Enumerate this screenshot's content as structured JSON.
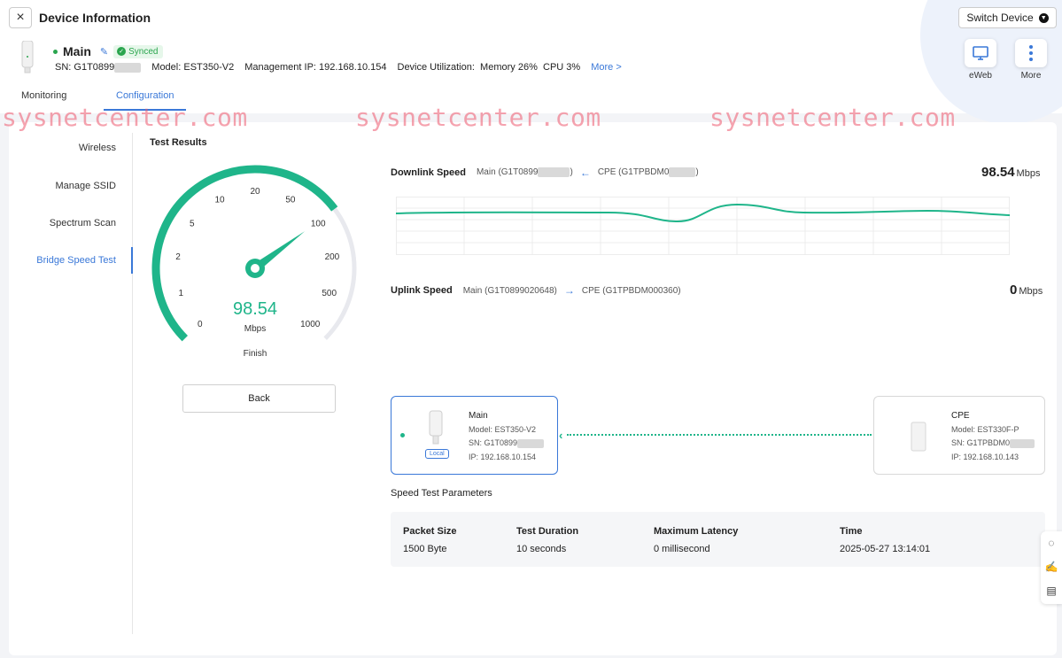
{
  "header": {
    "close_icon": "×",
    "title": "Device Information",
    "switch_device_label": "Switch Device",
    "switch_device_icon": "chevron-down-icon"
  },
  "device": {
    "name": "Main",
    "synced_label": "Synced",
    "sn_label": "SN:",
    "sn_value": "G1T0899",
    "model_label": "Model:",
    "model_value": "EST350-V2",
    "mgmt_ip_label": "Management IP:",
    "mgmt_ip_value": "192.168.10.154",
    "utilization_label": "Device Utilization:",
    "memory_label": "Memory",
    "memory_value": "26%",
    "cpu_label": "CPU",
    "cpu_value": "3%",
    "more_label": "More >"
  },
  "actions": {
    "eweb_label": "eWeb",
    "more_label": "More"
  },
  "tabs": [
    {
      "label": "Monitoring",
      "active": false
    },
    {
      "label": "Configuration",
      "active": true
    }
  ],
  "watermark": "sysnetcenter.com",
  "sidenav": [
    {
      "label": "Wireless",
      "active": false
    },
    {
      "label": "Manage SSID",
      "active": false
    },
    {
      "label": "Spectrum Scan",
      "active": false
    },
    {
      "label": "Bridge Speed Test",
      "active": true
    }
  ],
  "gauge": {
    "section_title": "Test Results",
    "value": "98.54",
    "value_number": 98.54,
    "unit": "Mbps",
    "status": "Finish",
    "ticks": [
      "0",
      "1",
      "2",
      "5",
      "10",
      "20",
      "50",
      "100",
      "200",
      "500",
      "1000"
    ],
    "colors": {
      "fill": "#1fb58a",
      "track": "#e8e9ee"
    }
  },
  "back_label": "Back",
  "downlink": {
    "label": "Downlink Speed",
    "from": "Main",
    "from_sn": "(G1T0899",
    "to": "CPE",
    "to_sn": "(G1TPBDM0",
    "close_paren": ")",
    "value": "98.54",
    "unit": "Mbps"
  },
  "uplink": {
    "label": "Uplink Speed",
    "from": "Main",
    "from_sn": "(G1T0899020648)",
    "to": "CPE",
    "to_sn": "(G1TPBDM000360)",
    "value": "0",
    "unit": "Mbps"
  },
  "main_card": {
    "name": "Main",
    "model": "Model:  EST350-V2",
    "sn": "SN:  G1T0899",
    "ip": "IP:  192.168.10.154",
    "badge": "Local"
  },
  "cpe_card": {
    "name": "CPE",
    "model": "Model:  EST330F-P",
    "sn": "SN:  G1TPBDM0",
    "ip": "IP:  192.168.10.143"
  },
  "params": {
    "title": "Speed Test Parameters",
    "packet_size_label": "Packet Size",
    "packet_size_value": "1500 Byte",
    "duration_label": "Test Duration",
    "duration_value": "10 seconds",
    "latency_label": "Maximum Latency",
    "latency_value": "0 millisecond",
    "time_label": "Time",
    "time_value": "2025-05-27 13:14:01"
  },
  "accent_color": "#3a78d8",
  "link_color": "#1fb58a"
}
